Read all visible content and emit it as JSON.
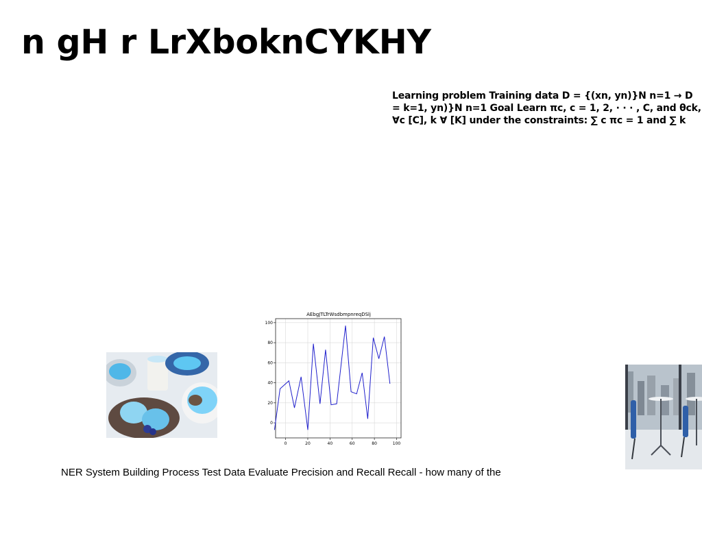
{
  "page": {
    "title": "n gH r LrXboknCYKHY",
    "math_block": "Learning problem Training data D = {(xn, yn)}N n=1 → D = k=1, yn)}N n=1 Goal Learn πc, c = 1, 2, · · · , C, and θck, ∀c [C], k ∀ [K] under the constraints: ∑ c πc = 1 and ∑ k",
    "caption": "NER System Building Process Test Data Evaluate Precision and Recall Recall - how many of the"
  },
  "images": {
    "food_photo": "food-photo",
    "city_photo": "city-interior-photo"
  },
  "chart_data": {
    "type": "line",
    "title": "AEbgJTLTrWsdbmpnreqDSlj",
    "xlabel": "",
    "ylabel": "",
    "xlim": [
      -9,
      104
    ],
    "ylim": [
      -15,
      104
    ],
    "xticks": [
      0,
      20,
      40,
      60,
      80,
      100
    ],
    "yticks": [
      0,
      20,
      40,
      60,
      80,
      100
    ],
    "grid": true,
    "series": [
      {
        "color": "#1f1fcc",
        "x": [
          -10,
          -5,
          3,
          8,
          14,
          20,
          25,
          31,
          36,
          41,
          46,
          54,
          59,
          64,
          69,
          74,
          79,
          84,
          89,
          94
        ],
        "y": [
          -7,
          34,
          42,
          15,
          46,
          -7,
          79,
          19,
          73,
          18,
          19,
          97,
          31,
          29,
          50,
          4,
          85,
          64,
          86,
          39
        ]
      }
    ]
  }
}
